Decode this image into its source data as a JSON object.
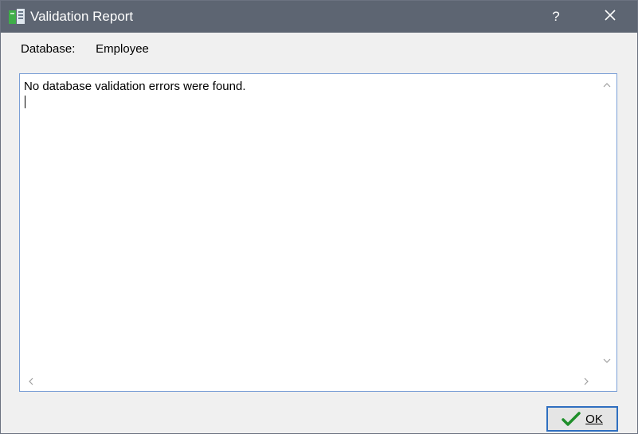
{
  "window": {
    "title": "Validation Report",
    "help_glyph": "?",
    "close_glyph": "✕"
  },
  "database": {
    "label": "Database:",
    "value": "Employee"
  },
  "report": {
    "text": "No database validation errors were found."
  },
  "buttons": {
    "ok_label": "OK",
    "ok_icon": "checkmark-icon"
  },
  "colors": {
    "titlebar": "#5d6572",
    "focus_border": "#7a9fd6",
    "check_green": "#1f8f2a"
  }
}
